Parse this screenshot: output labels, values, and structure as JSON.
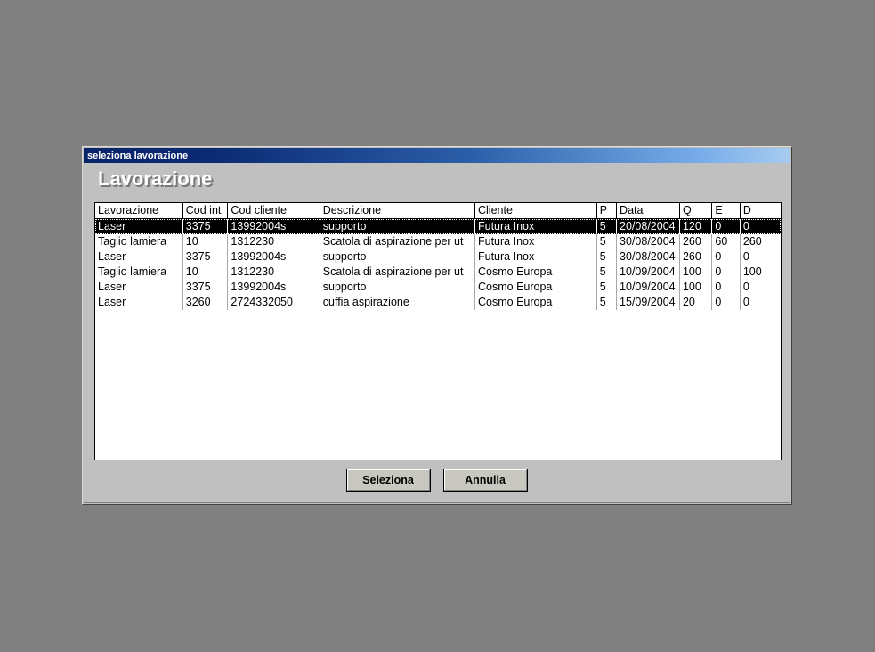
{
  "desktop": {
    "background_color": "#808080"
  },
  "dialog": {
    "titlebar": {
      "title": "seleziona lavorazione",
      "gradient_from": "#0a246a",
      "gradient_to": "#a6cbf0"
    },
    "heading": "Lavorazione",
    "table": {
      "columns": [
        "Lavorazione",
        "Cod int",
        "Cod cliente",
        "Descrizione",
        "Cliente",
        "P",
        "Data",
        "Q",
        "E",
        "D"
      ],
      "rows": [
        {
          "lavorazione": "Laser",
          "cod_int": "3375",
          "cod_cliente": "13992004s",
          "descrizione": "supporto",
          "cliente": "Futura Inox",
          "p": "5",
          "data": "20/08/2004",
          "q": "120",
          "e": "0",
          "d": "0",
          "selected": true
        },
        {
          "lavorazione": "Taglio lamiera",
          "cod_int": "10",
          "cod_cliente": "1312230",
          "descrizione": "Scatola di aspirazione per ut",
          "cliente": "Futura Inox",
          "p": "5",
          "data": "30/08/2004",
          "q": "260",
          "e": "60",
          "d": "260",
          "selected": false
        },
        {
          "lavorazione": "Laser",
          "cod_int": "3375",
          "cod_cliente": "13992004s",
          "descrizione": "supporto",
          "cliente": "Futura Inox",
          "p": "5",
          "data": "30/08/2004",
          "q": "260",
          "e": "0",
          "d": "0",
          "selected": false
        },
        {
          "lavorazione": "Taglio lamiera",
          "cod_int": "10",
          "cod_cliente": "1312230",
          "descrizione": "Scatola di aspirazione per ut",
          "cliente": "Cosmo Europa",
          "p": "5",
          "data": "10/09/2004",
          "q": "100",
          "e": "0",
          "d": "100",
          "selected": false
        },
        {
          "lavorazione": "Laser",
          "cod_int": "3375",
          "cod_cliente": "13992004s",
          "descrizione": "supporto",
          "cliente": "Cosmo Europa",
          "p": "5",
          "data": "10/09/2004",
          "q": "100",
          "e": "0",
          "d": "0",
          "selected": false
        },
        {
          "lavorazione": "Laser",
          "cod_int": "3260",
          "cod_cliente": "2724332050",
          "descrizione": "cuffia aspirazione",
          "cliente": "Cosmo Europa",
          "p": "5",
          "data": "15/09/2004",
          "q": "20",
          "e": "0",
          "d": "0",
          "selected": false
        }
      ]
    },
    "buttons": {
      "select": {
        "label": "Seleziona",
        "accel": "S",
        "rest": "eleziona"
      },
      "cancel": {
        "label": "Annulla",
        "accel": "A",
        "rest": "nnulla"
      }
    }
  }
}
